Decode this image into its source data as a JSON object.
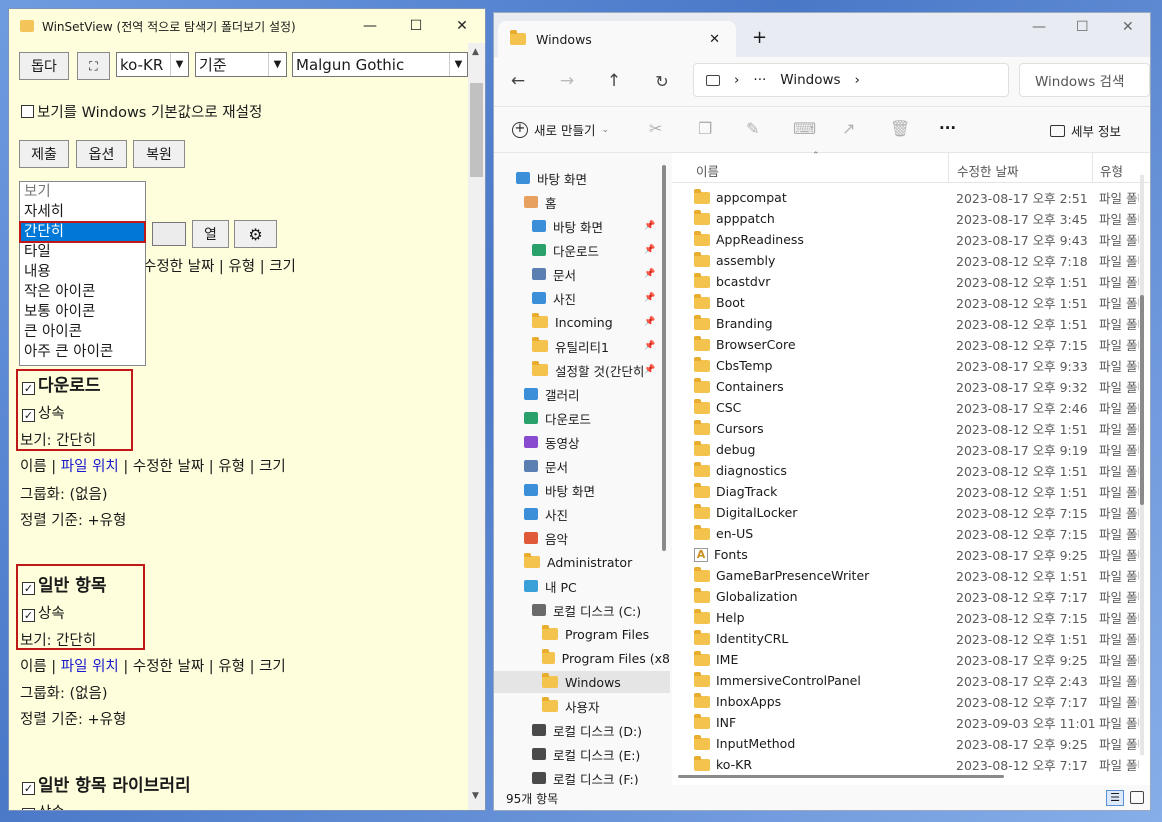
{
  "left_window": {
    "title": "WinSetView (전역 적으로 탐색기 폴더보기 설정)",
    "help_button": "돕다",
    "expand_glyph": "⛶",
    "language": "ko-KR",
    "base_select": "기준",
    "font_select": "Malgun Gothic",
    "reset_checkbox_label": "보기를 Windows 기본값으로 재설정",
    "submit_button": "제출",
    "options_button": "옵션",
    "restore_button": "복원",
    "columns_button": "열",
    "view_dropdown_options": [
      "보기",
      "자세히",
      "간단히",
      "타일",
      "내용",
      "작은 아이콘",
      "보통 아이콘",
      "큰 아이콘",
      "아주 큰 아이콘"
    ],
    "view_dropdown_selected": "간단히",
    "behind_dropdown_columns": "수정한 날짜 | 유형 | 크기",
    "sections": [
      {
        "header": "다운로드",
        "inherit": "상속",
        "view": "보기: 간단히",
        "cols_pre": "이름 | ",
        "cols_link": "파일 위치",
        "cols_post": " | 수정한 날짜 | 유형 | 크기",
        "group": "그룹화: (없음)",
        "sort": "정렬 기준: +유형"
      },
      {
        "header": "일반 항목",
        "inherit": "상속",
        "view": "보기: 간단히",
        "cols_pre": "이름 | ",
        "cols_link": "파일 위치",
        "cols_post": " | 수정한 날짜 | 유형 | 크기",
        "group": "그룹화: (없음)",
        "sort": "정렬 기준: +유형"
      },
      {
        "header": "일반 항목 라이브러리",
        "inherit": "상속"
      }
    ]
  },
  "right_window": {
    "tab_title": "Windows",
    "new_tab": "+",
    "address_dots": "···",
    "address_current": "Windows",
    "search_placeholder": "Windows 검색",
    "new_button": "새로 만들기",
    "details_button": "세부 정보",
    "more": "···",
    "nav_items": [
      {
        "label": "바탕 화면",
        "level": 0,
        "icon": "desktop-icon",
        "color": "#3a8fd8"
      },
      {
        "label": "홈",
        "level": 1,
        "icon": "home-icon",
        "color": "#e8a060"
      },
      {
        "label": "바탕 화면",
        "level": 2,
        "icon": "desktop-icon",
        "color": "#3a8fd8",
        "pinned": true
      },
      {
        "label": "다운로드",
        "level": 2,
        "icon": "download-icon",
        "color": "#2aa06a",
        "pinned": true
      },
      {
        "label": "문서",
        "level": 2,
        "icon": "document-icon",
        "color": "#5a7fb0",
        "pinned": true
      },
      {
        "label": "사진",
        "level": 2,
        "icon": "pictures-icon",
        "color": "#3a8fd8",
        "pinned": true
      },
      {
        "label": "Incoming",
        "level": 2,
        "icon": "folder-icon",
        "color": "#f4c34e",
        "pinned": true
      },
      {
        "label": "유틸리티1",
        "level": 2,
        "icon": "folder-icon",
        "color": "#f4c34e",
        "pinned": true
      },
      {
        "label": "설정할 것(간단히",
        "level": 2,
        "icon": "folder-icon",
        "color": "#f4c34e",
        "pinned": true
      },
      {
        "label": "갤러리",
        "level": 1,
        "icon": "gallery-icon",
        "color": "#3a8fd8"
      },
      {
        "label": "다운로드",
        "level": 1,
        "icon": "download-icon",
        "color": "#2aa06a"
      },
      {
        "label": "동영상",
        "level": 1,
        "icon": "video-icon",
        "color": "#8a4ad0"
      },
      {
        "label": "문서",
        "level": 1,
        "icon": "document-icon",
        "color": "#5a7fb0"
      },
      {
        "label": "바탕 화면",
        "level": 1,
        "icon": "desktop-icon",
        "color": "#3a8fd8"
      },
      {
        "label": "사진",
        "level": 1,
        "icon": "pictures-icon",
        "color": "#3a8fd8"
      },
      {
        "label": "음악",
        "level": 1,
        "icon": "music-icon",
        "color": "#e05a3a"
      },
      {
        "label": "Administrator",
        "level": 1,
        "icon": "folder-icon",
        "color": "#f4c34e"
      },
      {
        "label": "내 PC",
        "level": 1,
        "icon": "pc-icon",
        "color": "#3aa0d8"
      },
      {
        "label": "로컬 디스크 (C:)",
        "level": 2,
        "icon": "drive-icon",
        "color": "#6a6a6a"
      },
      {
        "label": "Program Files",
        "level": 3,
        "icon": "folder-icon",
        "color": "#f4c34e"
      },
      {
        "label": "Program Files (x8",
        "level": 3,
        "icon": "folder-icon",
        "color": "#f4c34e"
      },
      {
        "label": "Windows",
        "level": 3,
        "icon": "folder-icon",
        "color": "#f4c34e",
        "selected": true
      },
      {
        "label": "사용자",
        "level": 3,
        "icon": "folder-icon",
        "color": "#f4c34e"
      },
      {
        "label": "로컬 디스크 (D:)",
        "level": 2,
        "icon": "drive-icon",
        "color": "#4a4a4a"
      },
      {
        "label": "로컬 디스크 (E:)",
        "level": 2,
        "icon": "drive-icon",
        "color": "#4a4a4a"
      },
      {
        "label": "로컬 디스크 (F:)",
        "level": 2,
        "icon": "drive-icon",
        "color": "#4a4a4a"
      }
    ],
    "columns": {
      "name": "이름",
      "date": "수정한 날짜",
      "type": "유형"
    },
    "files": [
      {
        "name": "appcompat",
        "date": "2023-08-17 오후 2:51",
        "type": "파일 폴더"
      },
      {
        "name": "apppatch",
        "date": "2023-08-17 오후 3:45",
        "type": "파일 폴더"
      },
      {
        "name": "AppReadiness",
        "date": "2023-08-17 오후 9:43",
        "type": "파일 폴더"
      },
      {
        "name": "assembly",
        "date": "2023-08-12 오후 7:18",
        "type": "파일 폴더"
      },
      {
        "name": "bcastdvr",
        "date": "2023-08-12 오후 1:51",
        "type": "파일 폴더"
      },
      {
        "name": "Boot",
        "date": "2023-08-12 오후 1:51",
        "type": "파일 폴더"
      },
      {
        "name": "Branding",
        "date": "2023-08-12 오후 1:51",
        "type": "파일 폴더"
      },
      {
        "name": "BrowserCore",
        "date": "2023-08-12 오후 7:15",
        "type": "파일 폴더"
      },
      {
        "name": "CbsTemp",
        "date": "2023-08-17 오후 9:33",
        "type": "파일 폴더"
      },
      {
        "name": "Containers",
        "date": "2023-08-17 오후 9:32",
        "type": "파일 폴더"
      },
      {
        "name": "CSC",
        "date": "2023-08-17 오후 2:46",
        "type": "파일 폴더"
      },
      {
        "name": "Cursors",
        "date": "2023-08-12 오후 1:51",
        "type": "파일 폴더"
      },
      {
        "name": "debug",
        "date": "2023-08-17 오후 9:19",
        "type": "파일 폴더"
      },
      {
        "name": "diagnostics",
        "date": "2023-08-12 오후 1:51",
        "type": "파일 폴더"
      },
      {
        "name": "DiagTrack",
        "date": "2023-08-12 오후 1:51",
        "type": "파일 폴더"
      },
      {
        "name": "DigitalLocker",
        "date": "2023-08-12 오후 7:15",
        "type": "파일 폴더"
      },
      {
        "name": "en-US",
        "date": "2023-08-12 오후 7:15",
        "type": "파일 폴더"
      },
      {
        "name": "Fonts",
        "date": "2023-08-17 오후 9:25",
        "type": "파일 폴더",
        "special": true
      },
      {
        "name": "GameBarPresenceWriter",
        "date": "2023-08-12 오후 1:51",
        "type": "파일 폴더"
      },
      {
        "name": "Globalization",
        "date": "2023-08-12 오후 7:17",
        "type": "파일 폴더"
      },
      {
        "name": "Help",
        "date": "2023-08-12 오후 7:15",
        "type": "파일 폴더"
      },
      {
        "name": "IdentityCRL",
        "date": "2023-08-12 오후 1:51",
        "type": "파일 폴더"
      },
      {
        "name": "IME",
        "date": "2023-08-17 오후 9:25",
        "type": "파일 폴더"
      },
      {
        "name": "ImmersiveControlPanel",
        "date": "2023-08-17 오후 2:43",
        "type": "파일 폴더"
      },
      {
        "name": "InboxApps",
        "date": "2023-08-12 오후 7:17",
        "type": "파일 폴더"
      },
      {
        "name": "INF",
        "date": "2023-09-03 오후 11:01",
        "type": "파일 폴더"
      },
      {
        "name": "InputMethod",
        "date": "2023-08-17 오후 9:25",
        "type": "파일 폴더"
      },
      {
        "name": "ko-KR",
        "date": "2023-08-12 오후 7:17",
        "type": "파일 폴더"
      }
    ],
    "status": "95개 항목"
  }
}
